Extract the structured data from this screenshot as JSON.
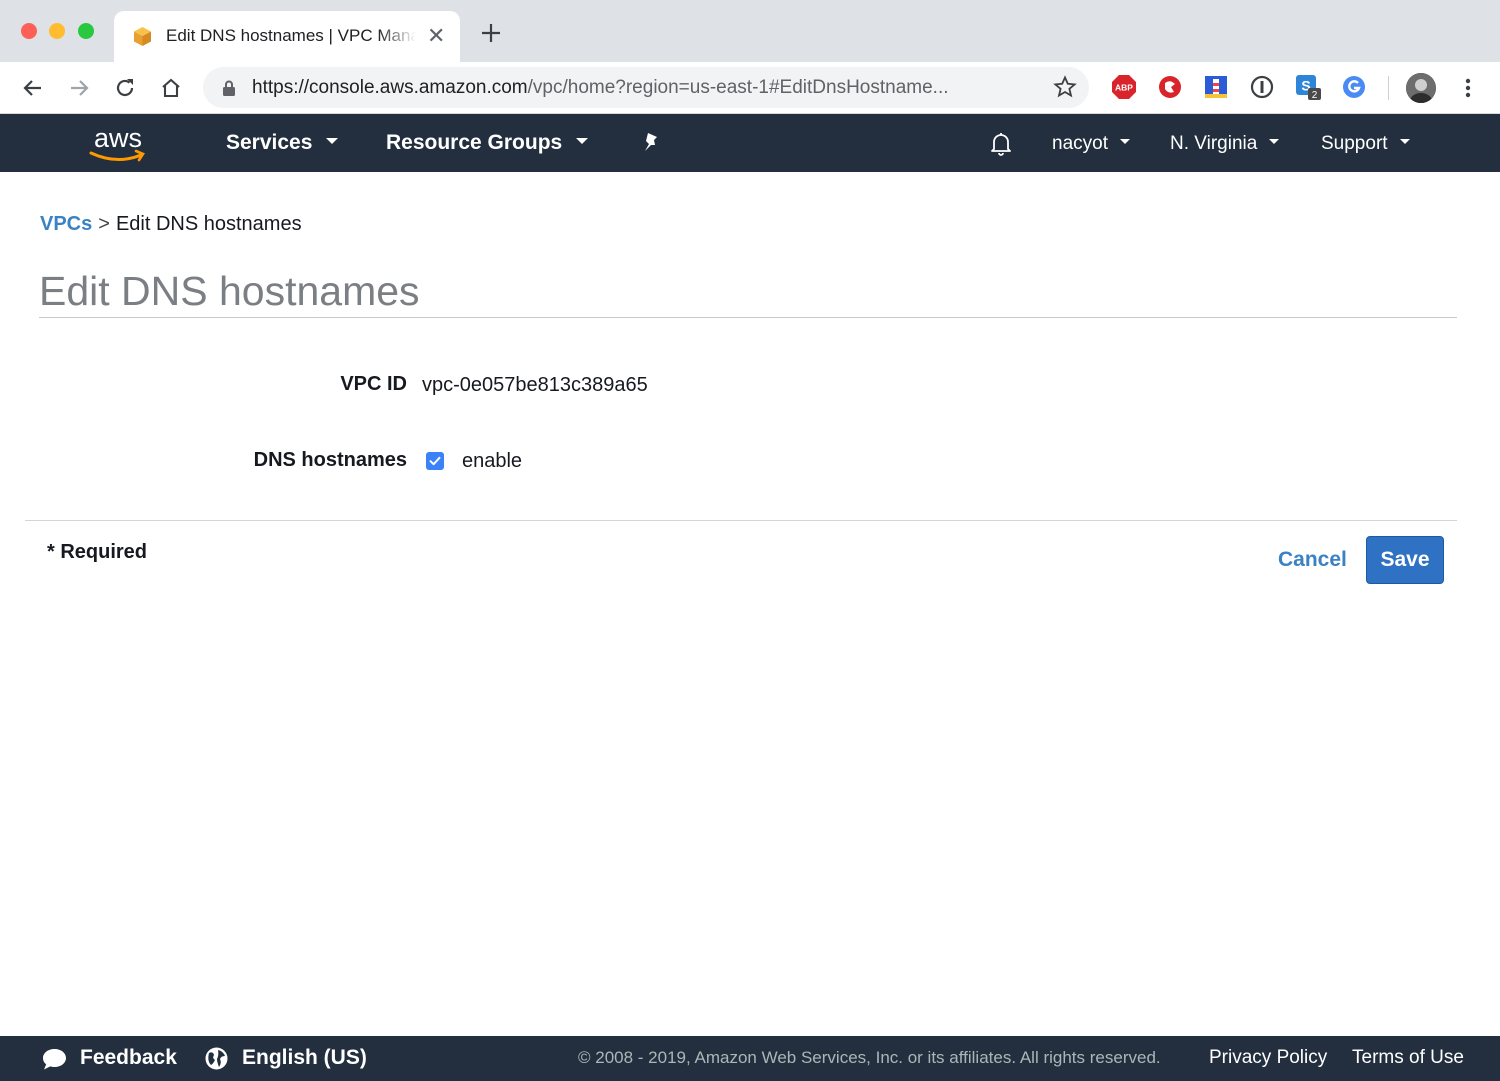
{
  "browser": {
    "tab_title": "Edit DNS hostnames | VPC Management Console",
    "url_host": "https://console.aws.amazon.com",
    "url_path": "/vpc/home?region=us-east-1#EditDnsHostname...",
    "ext_s_badge": "2",
    "ext_abp_label": "ABP"
  },
  "nav": {
    "logo_text": "aws",
    "services": "Services",
    "resource_groups": "Resource Groups",
    "account": "nacyot",
    "region": "N. Virginia",
    "support": "Support"
  },
  "breadcrumb": {
    "parent": "VPCs",
    "separator": ">",
    "current": "Edit DNS hostnames"
  },
  "page": {
    "title": "Edit DNS hostnames"
  },
  "form": {
    "vpc_id_label": "VPC ID",
    "vpc_id_value": "vpc-0e057be813c389a65",
    "dns_label": "DNS hostnames",
    "dns_checkbox_label": "enable",
    "dns_enabled": true,
    "required_note": "* Required",
    "cancel": "Cancel",
    "save": "Save"
  },
  "footer": {
    "feedback": "Feedback",
    "language": "English (US)",
    "copyright": "© 2008 - 2019, Amazon Web Services, Inc. or its affiliates. All rights reserved.",
    "privacy": "Privacy Policy",
    "terms": "Terms of Use"
  },
  "colors": {
    "nav_bg": "#232f3e",
    "link_blue": "#3b82c4",
    "save_bg": "#2f72c3",
    "checkbox": "#3b82f6"
  }
}
